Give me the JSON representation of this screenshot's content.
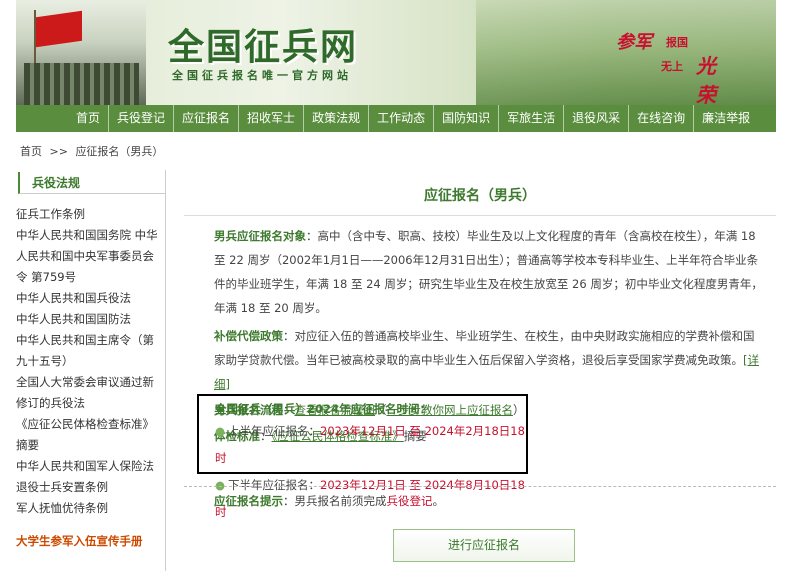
{
  "header": {
    "title": "全国征兵网",
    "subtitle": "全国征兵报名唯一官方网站",
    "slogan": {
      "part1": "参军",
      "part2": "报国",
      "part3": "无上",
      "part4": "光荣"
    }
  },
  "nav": {
    "items": [
      "首页",
      "兵役登记",
      "应征报名",
      "招收军士",
      "政策法规",
      "工作动态",
      "国防知识",
      "军旅生活",
      "退役风采",
      "在线咨询",
      "廉洁举报"
    ]
  },
  "breadcrumb": {
    "home": "首页",
    "sep": ">>",
    "current": "应征报名（男兵）"
  },
  "sidebar": {
    "heading": "兵役法规",
    "items": [
      "征兵工作条例",
      "中华人民共和国国务院 中华人民共和国中央军事委员会令 第759号",
      "中华人民共和国兵役法",
      "中华人民共和国国防法",
      "中华人民共和国主席令（第九十五号）",
      "全国人大常委会审议通过新修订的兵役法",
      "《应征公民体格检查标准》摘要",
      "中华人民共和国军人保险法",
      "退役士兵安置条例",
      "军人抚恤优待条例"
    ],
    "extra": "大学生参军入伍宣传手册"
  },
  "main": {
    "title": "应征报名（男兵）",
    "target": {
      "label": "男兵应征报名对象",
      "text": "：高中（含中专、职高、技校）毕业生及以上文化程度的青年（含高校在校生），年满 18 至 22 周岁（2002年1月1日——2006年12月31日出生）；普通高等学校本专科毕业生、上半年符合毕业条件的毕业班学生，年满 18 至 24 周岁；研究生毕业生及在校生放宽至 26 周岁；初中毕业文化程度男青年，年满 18 至 20 周岁。"
    },
    "policy": {
      "label": "补偿代偿政策",
      "text": "：对应征入伍的普通高校毕业生、毕业班学生、在校生，由中央财政实施相应的学费补偿和国家助学贷款代偿。当年已被高校录取的高中毕业生入伍后保留入学资格，退役后享受国家学费减免政策。",
      "link": "[详细]"
    },
    "process": {
      "label": "男兵报名流程",
      "colon": "：",
      "link1": "查看报名流程图",
      "mid": "（",
      "link2": "一步步教你网上应征报名",
      "end": "）"
    },
    "exam": {
      "label": "体检标准",
      "colon": "：",
      "link": "《应征公民体格检查标准》",
      "suffix": "摘要"
    },
    "schedule": {
      "title": "全国征兵（男兵）2024年应征报名时间：",
      "first_label": "上半年应征报名：",
      "first_dates": "2023年12月1日 至 2024年2月18日18时",
      "second_label": "下半年应征报名：",
      "second_dates": "2023年12月1日 至 2024年8月10日18时"
    },
    "tip": {
      "label": "应征报名提示",
      "text": "：男兵报名前须完成",
      "link": "兵役登记",
      "end": "。"
    },
    "button": "进行应征报名"
  },
  "colors": {
    "accent": "#3d7a2e",
    "nav": "#5a8e3e",
    "highlight": "#c8102e"
  }
}
